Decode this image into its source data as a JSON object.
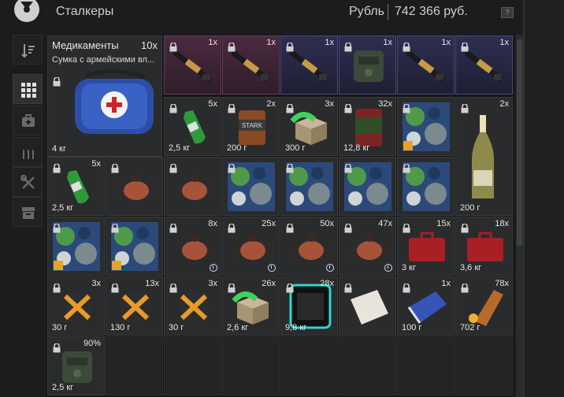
{
  "header": {
    "title": "Сталкеры",
    "currency_label": "Рубль",
    "currency_amount": "742 366 руб.",
    "help_label": "?"
  },
  "sidebar": {
    "items": [
      {
        "icon": "sort-icon",
        "active": false
      },
      {
        "icon": "grid-icon",
        "active": true
      },
      {
        "icon": "medkit-icon",
        "active": false
      },
      {
        "icon": "ammo-icon",
        "active": false
      },
      {
        "icon": "tools-icon",
        "active": false
      },
      {
        "icon": "box-icon",
        "active": false
      }
    ]
  },
  "featured": {
    "title": "Медикаменты",
    "qty": "10x",
    "subtitle": "Сумка с армейскими вл...",
    "weight": "4 кг"
  },
  "rows": [
    {
      "cells": [
        {
          "qty": "1x",
          "weight": "",
          "style": "purple",
          "icon": "rifle-icon"
        },
        {
          "qty": "1x",
          "weight": "",
          "style": "purple",
          "icon": "rifle-icon"
        },
        {
          "qty": "1x",
          "weight": "",
          "style": "blue",
          "icon": "rifle-icon"
        },
        {
          "qty": "1x",
          "weight": "",
          "style": "blue",
          "icon": "armor-icon"
        },
        {
          "qty": "1x",
          "weight": "",
          "style": "blue",
          "icon": "rifle-icon"
        },
        {
          "qty": "1x",
          "weight": "",
          "style": "blue",
          "icon": "rifle-icon"
        }
      ]
    },
    {
      "cells": [
        {
          "qty": "5x",
          "weight": "2,5 кг",
          "icon": "bottle-icon"
        },
        {
          "qty": "2x",
          "weight": "200 г",
          "icon": "can-icon"
        },
        {
          "qty": "3x",
          "weight": "300 г",
          "icon": "box-icon"
        },
        {
          "qty": "32x",
          "weight": "12,8 кг",
          "icon": "barrel-icon"
        },
        {
          "qty": "",
          "weight": "",
          "icon": "camo-icon"
        },
        {
          "qty": "2x",
          "weight": "200 г",
          "icon": "champagne-icon"
        }
      ]
    },
    {
      "cells": [
        {
          "qty": "5x",
          "weight": "2,5 кг",
          "icon": "bottle-icon"
        },
        {
          "qty": "",
          "weight": "",
          "icon": "tick-icon"
        },
        {
          "qty": "",
          "weight": "",
          "icon": "tick-icon"
        },
        {
          "qty": "",
          "weight": "",
          "icon": "camo-icon"
        },
        {
          "qty": "",
          "weight": "",
          "icon": "camo-icon"
        },
        {
          "qty": "",
          "weight": "",
          "icon": "camo-icon"
        },
        {
          "qty": "",
          "weight": "",
          "icon": "camo-icon"
        }
      ]
    },
    {
      "cells": [
        {
          "qty": "",
          "weight": "",
          "icon": "camo-icon"
        },
        {
          "qty": "",
          "weight": "",
          "icon": "camo-icon"
        },
        {
          "qty": "8x",
          "weight": "",
          "icon": "tick-icon"
        },
        {
          "qty": "25x",
          "weight": "",
          "icon": "tick-icon"
        },
        {
          "qty": "50x",
          "weight": "",
          "icon": "tick-icon"
        },
        {
          "qty": "47x",
          "weight": "",
          "icon": "tick-icon"
        },
        {
          "qty": "15x",
          "weight": "3 кг",
          "icon": "case-icon"
        },
        {
          "qty": "18x",
          "weight": "3,6 кг",
          "icon": "case-icon"
        }
      ]
    },
    {
      "cells": [
        {
          "qty": "3x",
          "weight": "30 г",
          "icon": "patch-icon"
        },
        {
          "qty": "13x",
          "weight": "130 г",
          "icon": "patch-icon"
        },
        {
          "qty": "3x",
          "weight": "30 г",
          "icon": "patch-icon"
        },
        {
          "qty": "26x",
          "weight": "2,6 кг",
          "icon": "box-icon"
        },
        {
          "qty": "28x",
          "weight": "9,8 кг",
          "icon": "container-icon"
        },
        {
          "qty": "",
          "weight": "",
          "icon": "paper-icon"
        },
        {
          "qty": "1x",
          "weight": "100 г",
          "icon": "book-icon"
        },
        {
          "qty": "78x",
          "weight": "702 г",
          "icon": "bullet-icon"
        }
      ]
    },
    {
      "cells": [
        {
          "qty": "90%",
          "weight": "2,5 кг",
          "icon": "armor-icon"
        }
      ]
    }
  ]
}
